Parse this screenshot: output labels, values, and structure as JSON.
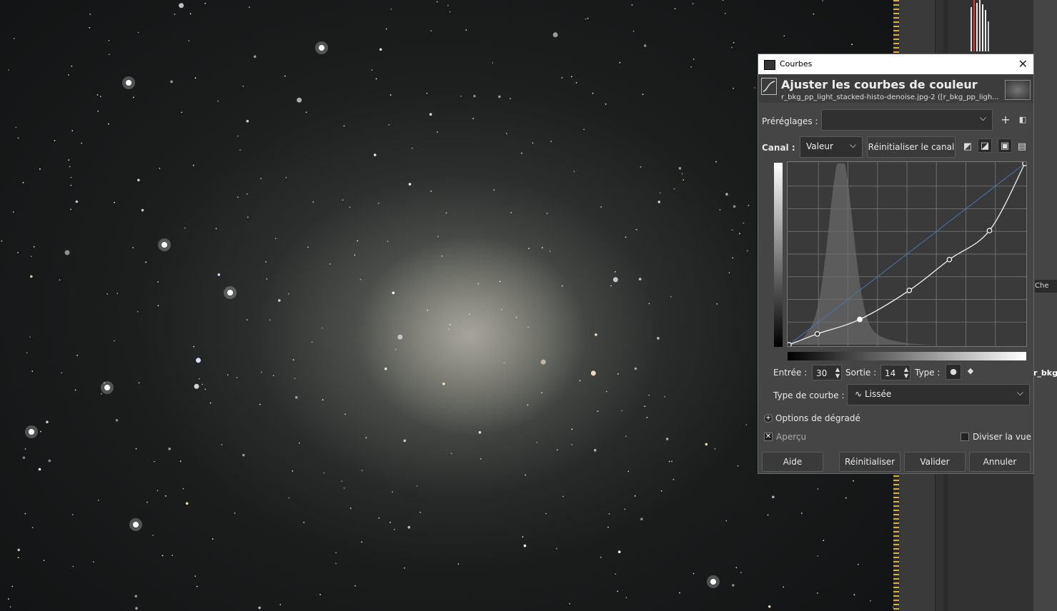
{
  "dialog": {
    "window_title": "Courbes",
    "header_title": "Ajuster les courbes de couleur",
    "header_subtitle": "r_bkg_pp_light_stacked-histo-denoise.jpg-2 ([r_bkg_pp_ligh...",
    "presets_label": "Préréglages :",
    "presets_value": "",
    "channel_label": "Canal :",
    "channel_value": "Valeur",
    "reset_channel_label": "Réinitialiser le canal",
    "input_label": "Entrée :",
    "input_value": "30",
    "output_label": "Sortie :",
    "output_value": "14",
    "type_label": "Type :",
    "curve_type_label": "Type de courbe :",
    "curve_type_value": "Lissée",
    "gradient_options_label": "Options de dégradé",
    "preview_label": "Aperçu",
    "split_view_label": "Diviser la vue",
    "buttons": {
      "help": "Aide",
      "reset": "Réinitialiser",
      "ok": "Valider",
      "cancel": "Annuler"
    }
  },
  "right_panel": {
    "chip_label": "Che",
    "layer_name": "r_bkg"
  },
  "curve": {
    "control_points": [
      [
        0,
        0
      ],
      [
        12,
        6
      ],
      [
        30,
        14
      ],
      [
        51,
        30
      ],
      [
        68,
        47
      ],
      [
        85,
        63
      ],
      [
        100,
        100
      ]
    ],
    "histogram_peak": 22
  }
}
